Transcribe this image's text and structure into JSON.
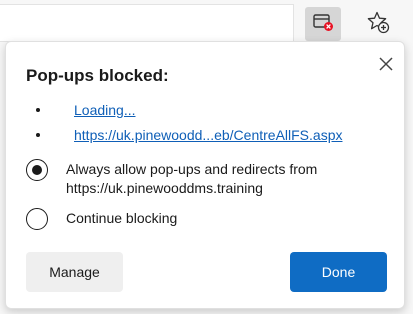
{
  "toolbar": {
    "popup_blocked_icon": "popup-blocked-icon",
    "favorites_icon": "favorites-add-icon"
  },
  "flyout": {
    "title": "Pop-ups blocked:",
    "blocked_items": [
      {
        "label": "Loading..."
      },
      {
        "label": "https://uk.pinewoodd...eb/CentreAllFS.aspx"
      }
    ],
    "options": [
      {
        "line1": "Always allow pop-ups and redirects from",
        "line2": "https://uk.pinewooddms.training",
        "selected": true
      },
      {
        "line1": "Continue blocking",
        "line2": "",
        "selected": false
      }
    ],
    "manage_label": "Manage",
    "done_label": "Done"
  },
  "colors": {
    "link": "#0f5fb7",
    "primary_button": "#0f6cc4",
    "blocked_badge": "#e81123"
  }
}
